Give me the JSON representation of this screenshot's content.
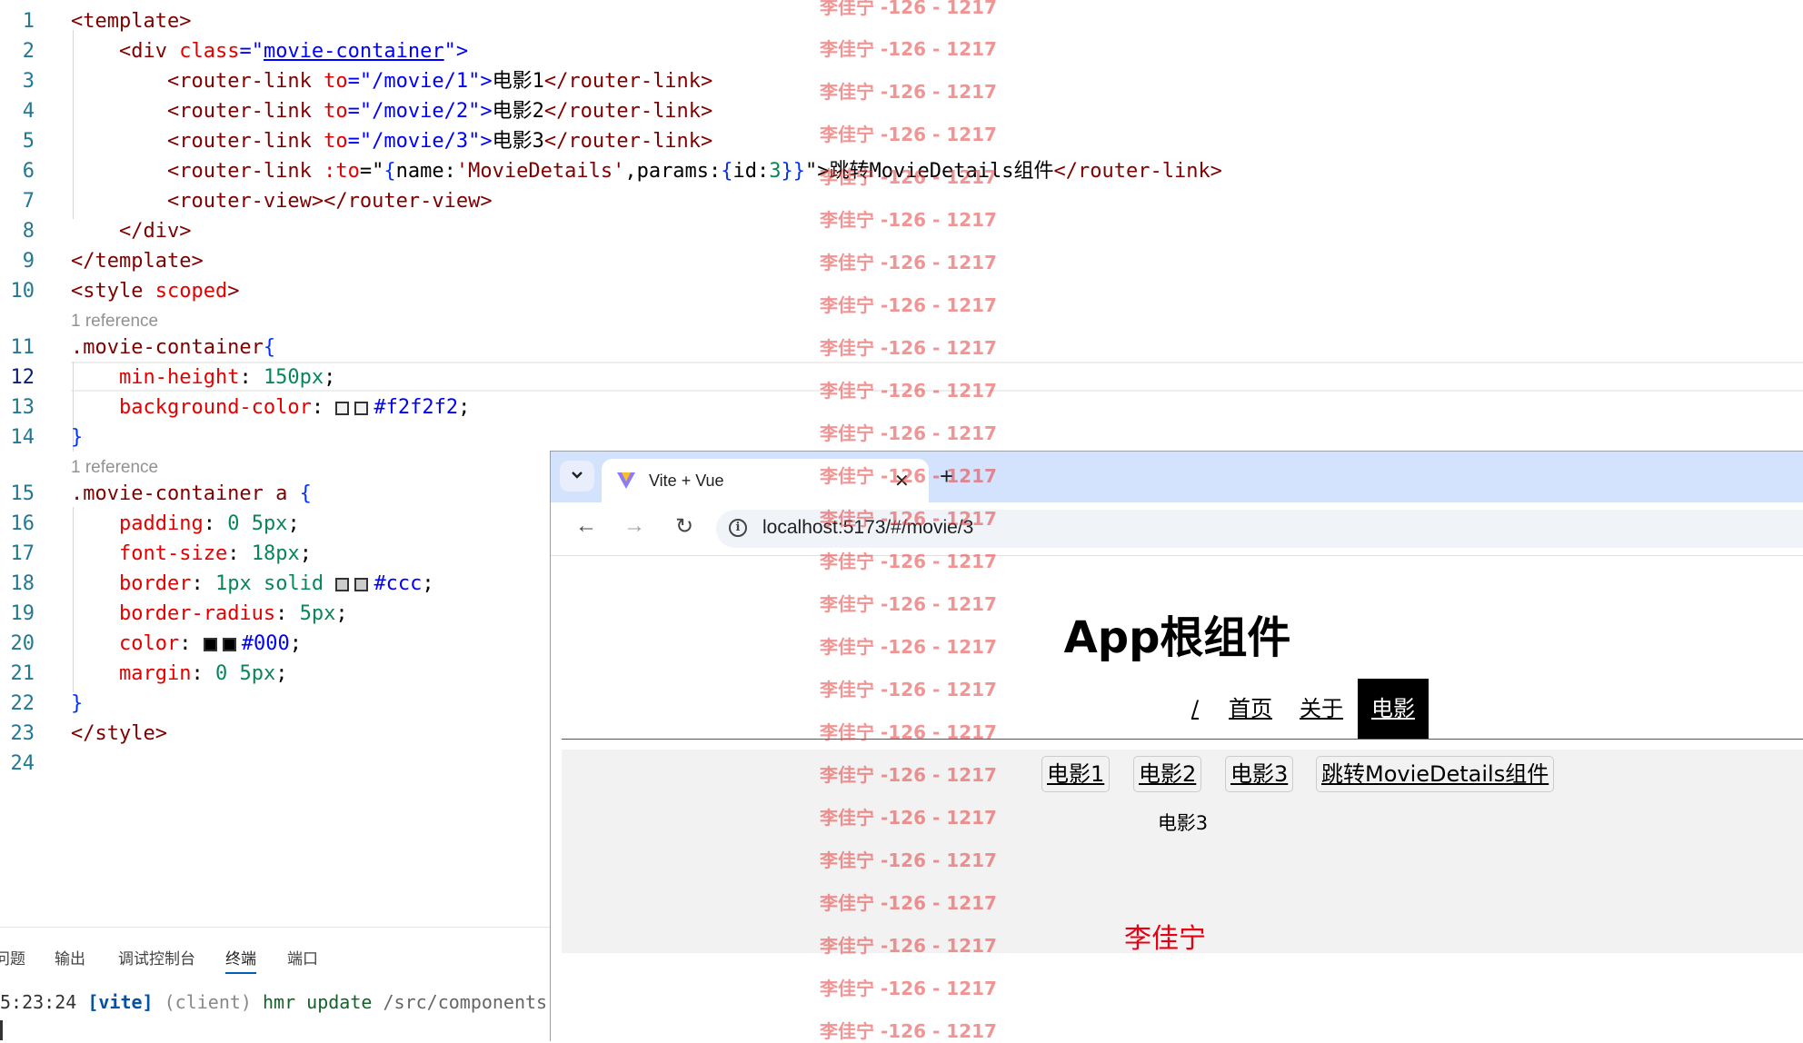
{
  "editor": {
    "lens_label": "1 reference",
    "lines": [
      {
        "n": "1"
      },
      {
        "n": "2"
      },
      {
        "n": "3"
      },
      {
        "n": "4"
      },
      {
        "n": "5"
      },
      {
        "n": "6"
      },
      {
        "n": "7"
      },
      {
        "n": "8"
      },
      {
        "n": "9"
      },
      {
        "n": "10"
      },
      {
        "n": "11"
      },
      {
        "n": "12"
      },
      {
        "n": "13"
      },
      {
        "n": "14"
      },
      {
        "n": "15"
      },
      {
        "n": "16"
      },
      {
        "n": "17"
      },
      {
        "n": "18"
      },
      {
        "n": "19"
      },
      {
        "n": "20"
      },
      {
        "n": "21"
      },
      {
        "n": "22"
      },
      {
        "n": "23"
      },
      {
        "n": "24"
      }
    ],
    "code": {
      "l1": [
        "<template>"
      ],
      "l2": [
        "<div ",
        "class",
        "=\"",
        "movie-container",
        "\">"
      ],
      "l3": [
        "<router-link ",
        "to",
        "=\"/movie/1\">",
        "电影1",
        "</router-link>"
      ],
      "l4": [
        "<router-link ",
        "to",
        "=\"/movie/2\">",
        "电影2",
        "</router-link>"
      ],
      "l5": [
        "<router-link ",
        "to",
        "=\"/movie/3\">",
        "电影3",
        "</router-link>"
      ],
      "l6": [
        "<router-link ",
        ":to",
        "=\"",
        "{",
        "name:",
        "'MovieDetails'",
        ",params:",
        "{",
        "id:",
        "3",
        "}}",
        "\">",
        "跳转MovieDetails组件",
        "</router-link>"
      ],
      "l7": [
        "<router-view></router-view>"
      ],
      "l8": [
        "</div>"
      ],
      "l9": [
        "</template>"
      ],
      "l10": [
        "<style ",
        "scoped",
        ">"
      ],
      "l11": [
        ".movie-container",
        "{"
      ],
      "l12": [
        "min-height",
        ": ",
        "150px",
        ";"
      ],
      "l13": [
        "background-color",
        ": ",
        "#f2f2f2",
        ";"
      ],
      "l14": [
        "}"
      ],
      "l15": [
        ".movie-container a ",
        "{"
      ],
      "l16": [
        "padding",
        ": ",
        "0 5px",
        ";"
      ],
      "l17": [
        "font-size",
        ": ",
        "18px",
        ";"
      ],
      "l18": [
        "border",
        ": ",
        "1px solid",
        "#ccc",
        ";"
      ],
      "l19": [
        "border-radius",
        ": ",
        "5px",
        ";"
      ],
      "l20": [
        "color",
        ": ",
        "#000",
        ";"
      ],
      "l21": [
        "margin",
        ": ",
        "0 5px",
        ";"
      ],
      "l22": [
        "}"
      ],
      "l23": [
        "</style>"
      ]
    },
    "colors": {
      "swatch_bg": "#f2f2f2",
      "swatch_border": "#cccccc",
      "swatch_color": "#000000"
    }
  },
  "panel": {
    "tabs": [
      "问题",
      "输出",
      "调试控制台",
      "终端",
      "端口"
    ],
    "active_tab": "终端",
    "terminal": {
      "time": "5:23:24",
      "tag": "[vite]",
      "client": "(client)",
      "msg": "hmr update",
      "path": "/src/components"
    }
  },
  "browser": {
    "tab_title": "Vite + Vue",
    "new_tab": "+",
    "url": "localhost:5173/#/movie/3",
    "page": {
      "title": "App根组件",
      "nav": [
        "/",
        "首页",
        "关于",
        "电影"
      ],
      "active_nav": "电影",
      "movie_links": [
        "电影1",
        "电影2",
        "电影3",
        "跳转MovieDetails组件"
      ],
      "router_view_text": "电影3",
      "footer_name": "李佳宁"
    }
  },
  "watermark": {
    "text": "李佳宁 -126 - 1217"
  }
}
